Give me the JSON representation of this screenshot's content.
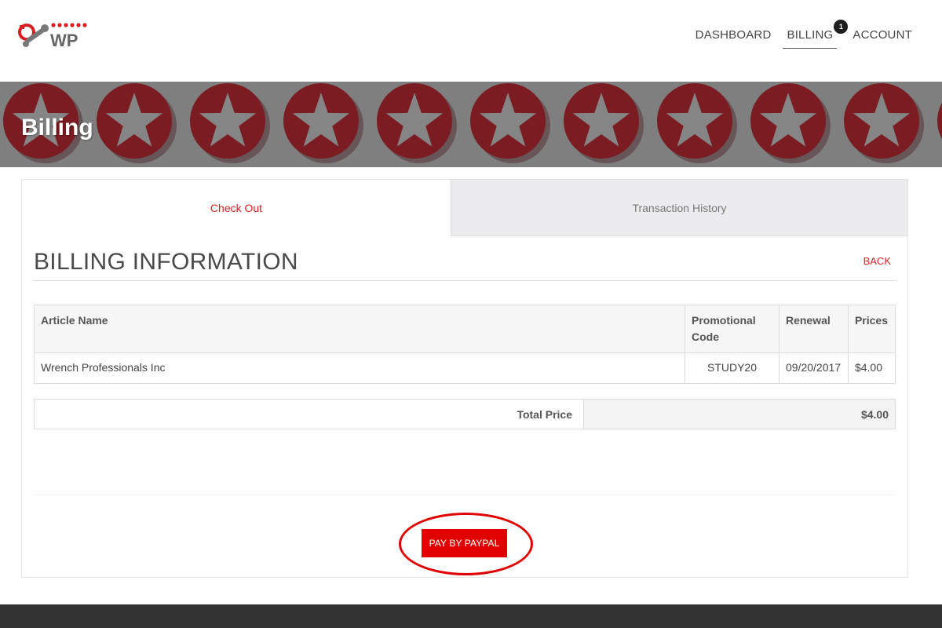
{
  "colors": {
    "accent": "#d42020",
    "button": "#e00000",
    "banner_bg": "#7f7f7f",
    "star_circle": "#7a1c22"
  },
  "header": {
    "logo_text": "WP",
    "nav": [
      {
        "label": "DASHBOARD"
      },
      {
        "label": "BILLING",
        "badge": "1"
      },
      {
        "label": "ACCOUNT"
      }
    ]
  },
  "banner": {
    "title": "Billing"
  },
  "tabs": [
    {
      "label": "Check Out"
    },
    {
      "label": "Transaction History"
    }
  ],
  "section": {
    "title": "BILLING INFORMATION",
    "back_label": "BACK"
  },
  "items_table": {
    "headers": [
      "Article Name",
      "Promotional Code",
      "Renewal",
      "Prices"
    ],
    "rows": [
      [
        "Wrench Professionals Inc",
        "STUDY20",
        "09/20/2017",
        "$4.00"
      ]
    ]
  },
  "total": {
    "label": "Total Price",
    "value": "$4.00"
  },
  "pay_button": {
    "label": "PAY BY PAYPAL"
  }
}
